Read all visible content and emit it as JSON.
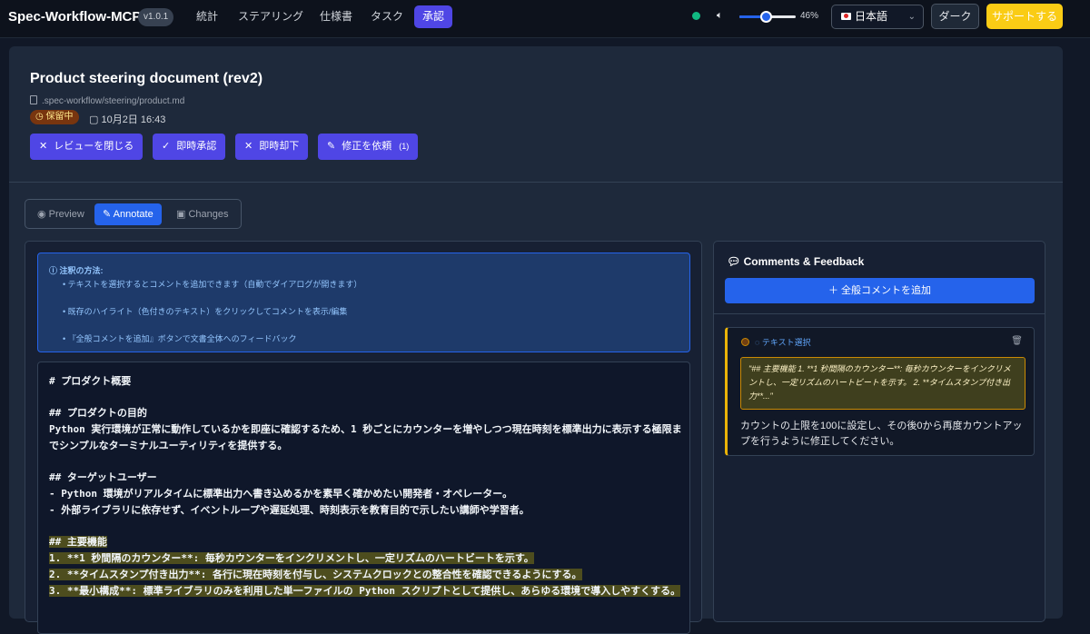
{
  "app": {
    "name": "Spec-Workflow-MCP",
    "version": "v1.0.1"
  },
  "nav": [
    {
      "label": "統計",
      "active": false
    },
    {
      "label": "ステアリング",
      "active": false
    },
    {
      "label": "仕様書",
      "active": false
    },
    {
      "label": "タスク",
      "active": false
    },
    {
      "label": "承認",
      "active": true
    }
  ],
  "volume": {
    "percent": 46,
    "label": "46%"
  },
  "language": {
    "selected": "日本語"
  },
  "theme_button": "ダーク",
  "support_button": "サポートする",
  "colors": {
    "accent": "#4f46e5",
    "primary_blue": "#2563eb",
    "support": "#facc15",
    "status_online": "#10b981",
    "highlight": "#4d4d1e"
  },
  "approval": {
    "title": "Product steering document (rev2)",
    "path": ".spec-workflow/steering/product.md",
    "status": "保留中",
    "date": "10月2日 16:43",
    "actions": [
      {
        "icon": "close-icon",
        "label": "レビューを閉じる"
      },
      {
        "icon": "check-icon",
        "label": "即時承認"
      },
      {
        "icon": "close-icon",
        "label": "即時却下"
      },
      {
        "icon": "edit-icon",
        "label": "修正を依頼",
        "count": "(1)"
      }
    ]
  },
  "view_tabs": [
    {
      "icon": "eye-icon",
      "label": "Preview",
      "active": false
    },
    {
      "icon": "edit-icon",
      "label": "Annotate",
      "active": true
    },
    {
      "icon": "terminal-icon",
      "label": "Changes",
      "active": false
    }
  ],
  "hint": {
    "heading": "注釈の方法:",
    "bullets": [
      "• テキストを選択するとコメントを追加できます（自動でダイアログが開きます）",
      "• 既存のハイライト（色付きのテキスト）をクリックしてコメントを表示/編集",
      "• 『全般コメントを追加』ボタンで文書全体へのフィードバック"
    ]
  },
  "document": {
    "lines": [
      {
        "text": "# プロダクト概要",
        "hl": false
      },
      {
        "text": "## プロダクトの目的",
        "hl": false
      },
      {
        "text": "Python 実行環境が正常に動作しているかを即座に確認するため、1 秒ごとにカウンターを増やしつつ現在時刻を標準出力に表示する極限ま",
        "hl": false
      },
      {
        "text": "でシンプルなターミナルユーティリティを提供する。",
        "hl": false
      },
      {
        "text": "## ターゲットユーザー",
        "hl": false
      },
      {
        "text": "- Python 環境がリアルタイムに標準出力へ書き込めるかを素早く確かめたい開発者・オペレーター。",
        "hl": false
      },
      {
        "text": "- 外部ライブラリに依存せず、イベントループや遅延処理、時刻表示を教育目的で示したい講師や学習者。",
        "hl": false
      },
      {
        "text": "## 主要機能",
        "hl": true
      },
      {
        "text": "1. **1 秒間隔のカウンター**: 毎秒カウンターをインクリメントし、一定リズムのハートビートを示す。",
        "hl": true
      },
      {
        "text": "2. **タイムスタンプ付き出力**: 各行に現在時刻を付与し、システムクロックとの整合性を確認できるようにする。",
        "hl": true
      },
      {
        "text": "3. **最小構成**: 標準ライブラリのみを利用した単一ファイルの Python スクリプトとして提供し、あらゆる環境で導入しやすくする。",
        "hl": true
      }
    ]
  },
  "comments_panel": {
    "title": "Comments & Feedback",
    "add_button": "＋  全般コメントを追加",
    "comments": [
      {
        "type": "テキスト選択",
        "quote": "\"## 主要機能 1. **1 秒間隔のカウンター**: 毎秒カウンターをインクリメントし、一定リズムのハートビートを示す。 2. **タイムスタンプ付き出力**...\"",
        "text": "カウントの上限を100に設定し、その後0から再度カウントアップを行うように修正してください。"
      }
    ]
  }
}
